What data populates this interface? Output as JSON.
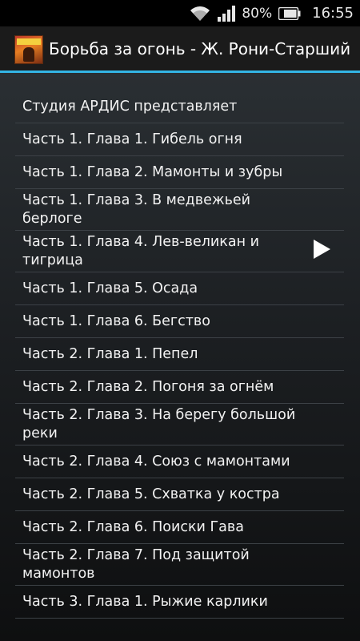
{
  "status_bar": {
    "battery_percent": "80%",
    "time": "16:55",
    "icons": [
      "wifi-icon",
      "signal-icon",
      "battery-icon"
    ]
  },
  "action_bar": {
    "title": "Борьба за огонь  -  Ж. Рони-Старший",
    "app_icon": "book-cover-icon"
  },
  "chapters": [
    {
      "label": "Студия АРДИС представляет"
    },
    {
      "label": "Часть 1. Глава 1. Гибель огня"
    },
    {
      "label": "Часть 1. Глава 2. Мамонты и зубры"
    },
    {
      "label": "Часть 1. Глава 3. В медвежьей берлоге"
    },
    {
      "label": "Часть 1. Глава 4. Лев-великан и тигрица"
    },
    {
      "label": "Часть 1. Глава 5. Осада"
    },
    {
      "label": "Часть 1. Глава 6. Бегство"
    },
    {
      "label": "Часть 2. Глава 1. Пепел"
    },
    {
      "label": "Часть 2. Глава 2. Погоня за огнём"
    },
    {
      "label": "Часть 2. Глава 3. На берегу большой реки"
    },
    {
      "label": "Часть 2. Глава 4. Союз с мамонтами"
    },
    {
      "label": "Часть 2. Глава 5. Схватка у костра"
    },
    {
      "label": "Часть 2. Глава 6. Поиски Гава"
    },
    {
      "label": "Часть 2. Глава 7. Под защитой мамонтов"
    },
    {
      "label": "Часть 3. Глава 1. Рыжие карлики"
    }
  ],
  "colors": {
    "accent": "#33b5e5",
    "action_bar_bg": "#1b1b1b",
    "text": "#f2f2f2"
  }
}
